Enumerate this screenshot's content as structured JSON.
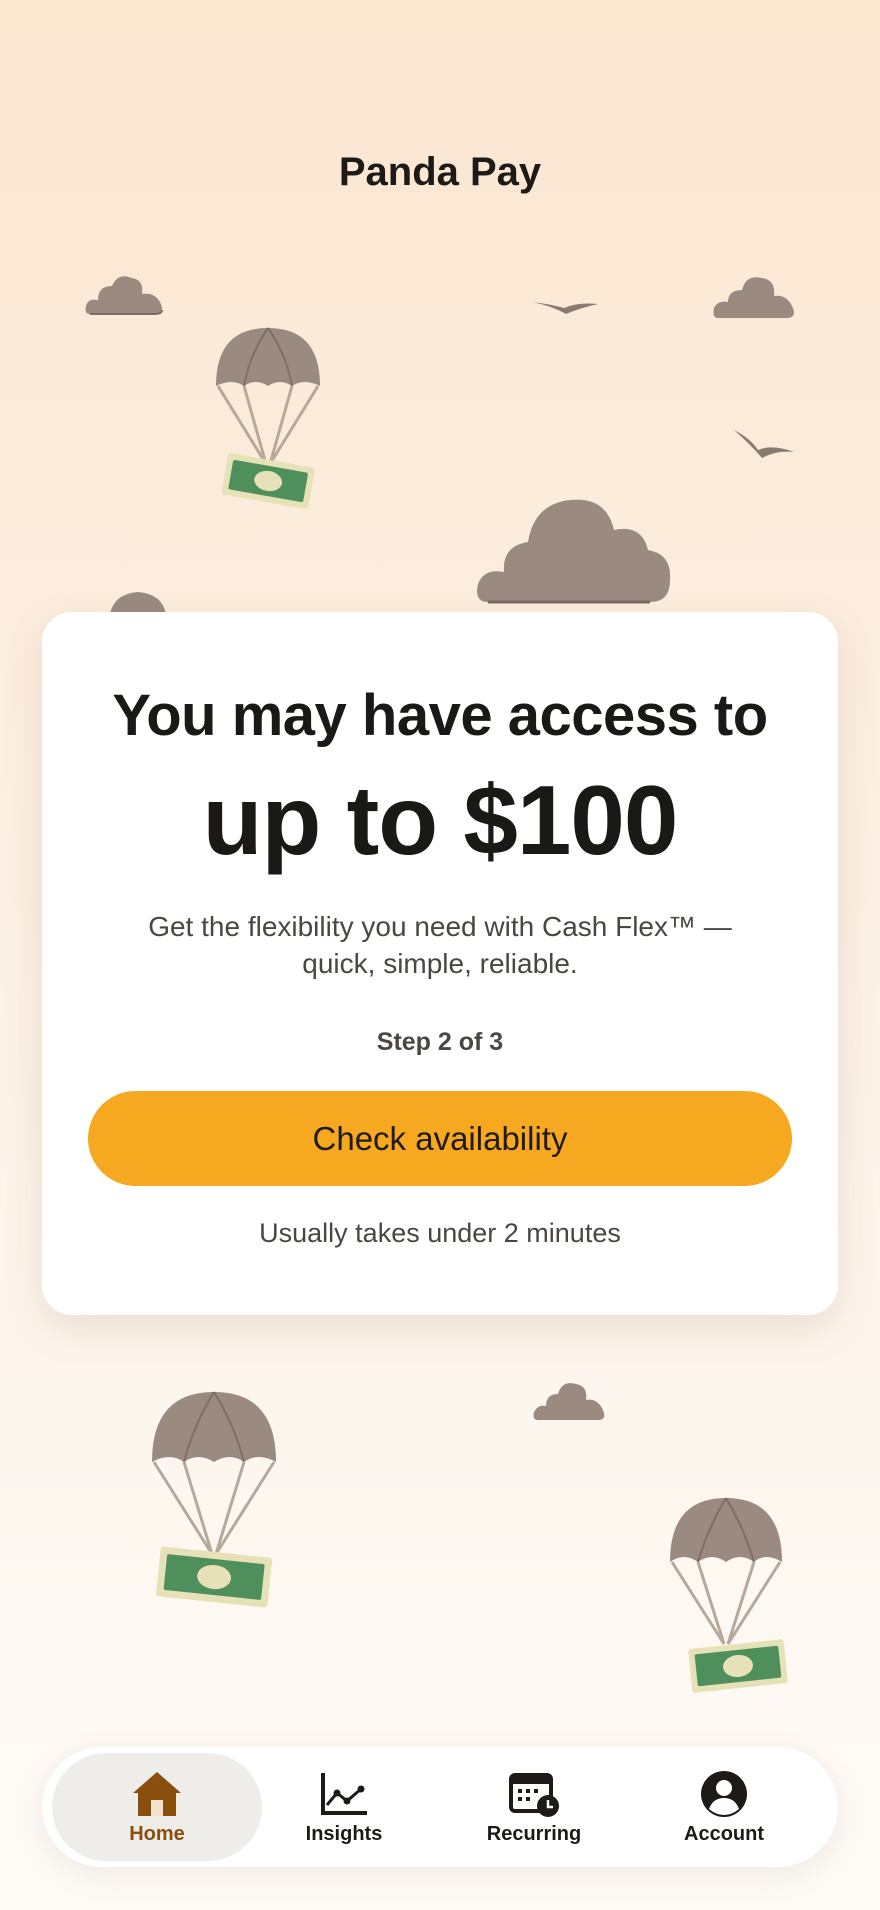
{
  "app": {
    "title": "Panda Pay"
  },
  "offer": {
    "headline": "You may have access to",
    "amount": "up to $100",
    "description": "Get the flexibility you need with Cash Flex™ — quick, simple, reliable.",
    "step": "Step 2 of 3",
    "cta_label": "Check availability",
    "note": "Usually takes under 2 minutes"
  },
  "colors": {
    "accent": "#f6a821",
    "active_nav": "#8a4f0c",
    "background": "#fbe6d0"
  },
  "nav": {
    "items": [
      {
        "label": "Home",
        "icon": "home-icon",
        "active": true
      },
      {
        "label": "Insights",
        "icon": "chart-icon",
        "active": false
      },
      {
        "label": "Recurring",
        "icon": "calendar-clock-icon",
        "active": false
      },
      {
        "label": "Account",
        "icon": "user-circle-icon",
        "active": false
      }
    ]
  }
}
